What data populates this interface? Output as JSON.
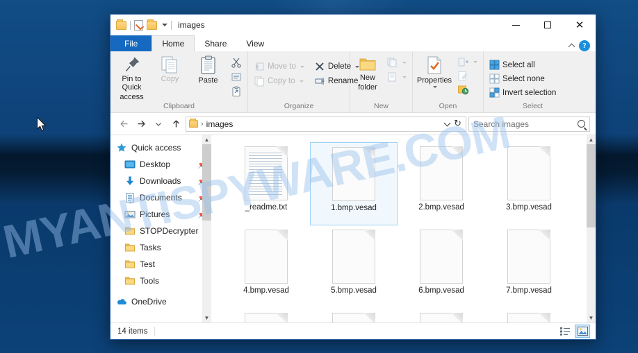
{
  "desktop": {
    "watermark": "MYANTISPYWARE.COM",
    "cursor_name": "mouse-pointer"
  },
  "window": {
    "title": "images",
    "quick_access": [
      {
        "name": "folder-icon",
        "label": ""
      },
      {
        "name": "properties-icon",
        "label": ""
      },
      {
        "name": "new-folder-icon",
        "label": ""
      },
      {
        "name": "customize-qat-caret",
        "label": ""
      }
    ],
    "controls": {
      "minimize": "—",
      "maximize": "□",
      "close": "✕"
    },
    "help_label": "?",
    "tabs": [
      {
        "label": "File",
        "state": "file"
      },
      {
        "label": "Home",
        "state": "active"
      },
      {
        "label": "Share",
        "state": "normal"
      },
      {
        "label": "View",
        "state": "normal"
      }
    ]
  },
  "ribbon": {
    "groups": [
      {
        "label": "Clipboard",
        "big_buttons": [
          {
            "label": "Pin to Quick\naccess",
            "line1": "Pin to Quick",
            "line2": "access",
            "icon": "pin-icon",
            "disabled": false
          },
          {
            "label": "Copy",
            "line1": "Copy",
            "line2": "",
            "icon": "copy-icon",
            "disabled": true
          },
          {
            "label": "Paste",
            "line1": "Paste",
            "line2": "",
            "icon": "paste-icon",
            "disabled": false
          }
        ],
        "small_buttons": [
          {
            "label": "",
            "icon": "cut-icon",
            "disabled": false
          },
          {
            "label": "",
            "icon": "copy-path-icon",
            "disabled": false
          },
          {
            "label": "",
            "icon": "paste-shortcut-icon",
            "disabled": false
          }
        ]
      },
      {
        "label": "Organize",
        "small_buttons": [
          {
            "label": "Move to",
            "icon": "move-to-icon",
            "disabled": true,
            "caret": true
          },
          {
            "label": "Copy to",
            "icon": "copy-to-icon",
            "disabled": true,
            "caret": true
          },
          {
            "label": "Delete",
            "icon": "delete-icon",
            "disabled": false,
            "caret": true
          },
          {
            "label": "Rename",
            "icon": "rename-icon",
            "disabled": false,
            "caret": false
          }
        ]
      },
      {
        "label": "New",
        "big_buttons": [
          {
            "line1": "New",
            "line2": "folder",
            "icon": "new-folder-icon",
            "disabled": false
          }
        ],
        "small_buttons": [
          {
            "label": "",
            "icon": "new-item-icon",
            "disabled": true,
            "caret": true
          },
          {
            "label": "",
            "icon": "easy-access-icon",
            "disabled": true,
            "caret": true
          }
        ]
      },
      {
        "label": "Open",
        "big_buttons": [
          {
            "line1": "Properties",
            "line2": "",
            "icon": "properties-icon",
            "disabled": false,
            "caret": true
          }
        ],
        "small_buttons": [
          {
            "label": "",
            "icon": "open-icon",
            "disabled": true,
            "caret": true
          },
          {
            "label": "",
            "icon": "edit-icon",
            "disabled": true,
            "caret": false
          },
          {
            "label": "",
            "icon": "history-icon",
            "disabled": false,
            "caret": false
          }
        ]
      },
      {
        "label": "Select",
        "small_buttons": [
          {
            "label": "Select all",
            "icon": "select-all-icon",
            "disabled": false,
            "caret": false
          },
          {
            "label": "Select none",
            "icon": "select-none-icon",
            "disabled": false,
            "caret": false
          },
          {
            "label": "Invert selection",
            "icon": "invert-selection-icon",
            "disabled": false,
            "caret": false
          }
        ]
      }
    ]
  },
  "address": {
    "back_icon": "back-arrow-icon",
    "forward_icon": "forward-arrow-icon",
    "recent_icon": "recent-locations-icon",
    "up_icon": "up-arrow-icon",
    "crumb_icon": "folder-icon",
    "separator": "›",
    "path": "images",
    "dropdown_icon": "chevron-down-icon",
    "refresh_icon": "refresh-icon"
  },
  "search": {
    "placeholder": "Search images",
    "icon": "search-icon"
  },
  "sidebar": {
    "items": [
      {
        "label": "Quick access",
        "icon": "star-icon",
        "pinned": false,
        "root": true
      },
      {
        "label": "Desktop",
        "icon": "desktop-icon",
        "pinned": true,
        "root": false
      },
      {
        "label": "Downloads",
        "icon": "downloads-icon",
        "pinned": true,
        "root": false
      },
      {
        "label": "Documents",
        "icon": "documents-icon",
        "pinned": true,
        "root": false
      },
      {
        "label": "Pictures",
        "icon": "pictures-icon",
        "pinned": true,
        "root": false
      },
      {
        "label": "STOPDecrypter",
        "icon": "folder-icon",
        "pinned": false,
        "root": false
      },
      {
        "label": "Tasks",
        "icon": "folder-icon",
        "pinned": false,
        "root": false
      },
      {
        "label": "Test",
        "icon": "folder-icon",
        "pinned": false,
        "root": false
      },
      {
        "label": "Tools",
        "icon": "folder-icon",
        "pinned": false,
        "root": false
      },
      {
        "label": "OneDrive",
        "icon": "onedrive-icon",
        "pinned": false,
        "root": true
      }
    ],
    "pin_glyph": "📌"
  },
  "files": [
    {
      "name": "_readme.txt",
      "icon": "text-file-icon",
      "selected": false
    },
    {
      "name": "1.bmp.vesad",
      "icon": "generic-file-icon",
      "selected": true
    },
    {
      "name": "2.bmp.vesad",
      "icon": "generic-file-icon",
      "selected": false
    },
    {
      "name": "3.bmp.vesad",
      "icon": "generic-file-icon",
      "selected": false
    },
    {
      "name": "4.bmp.vesad",
      "icon": "generic-file-icon",
      "selected": false
    },
    {
      "name": "5.bmp.vesad",
      "icon": "generic-file-icon",
      "selected": false
    },
    {
      "name": "6.bmp.vesad",
      "icon": "generic-file-icon",
      "selected": false
    },
    {
      "name": "7.bmp.vesad",
      "icon": "generic-file-icon",
      "selected": false
    }
  ],
  "partial_row_count": 4,
  "status": {
    "item_count": "14 items",
    "view_details_icon": "details-view-icon",
    "view_icons_icon": "large-icons-view-icon",
    "active_view": "large-icons-view-icon"
  }
}
